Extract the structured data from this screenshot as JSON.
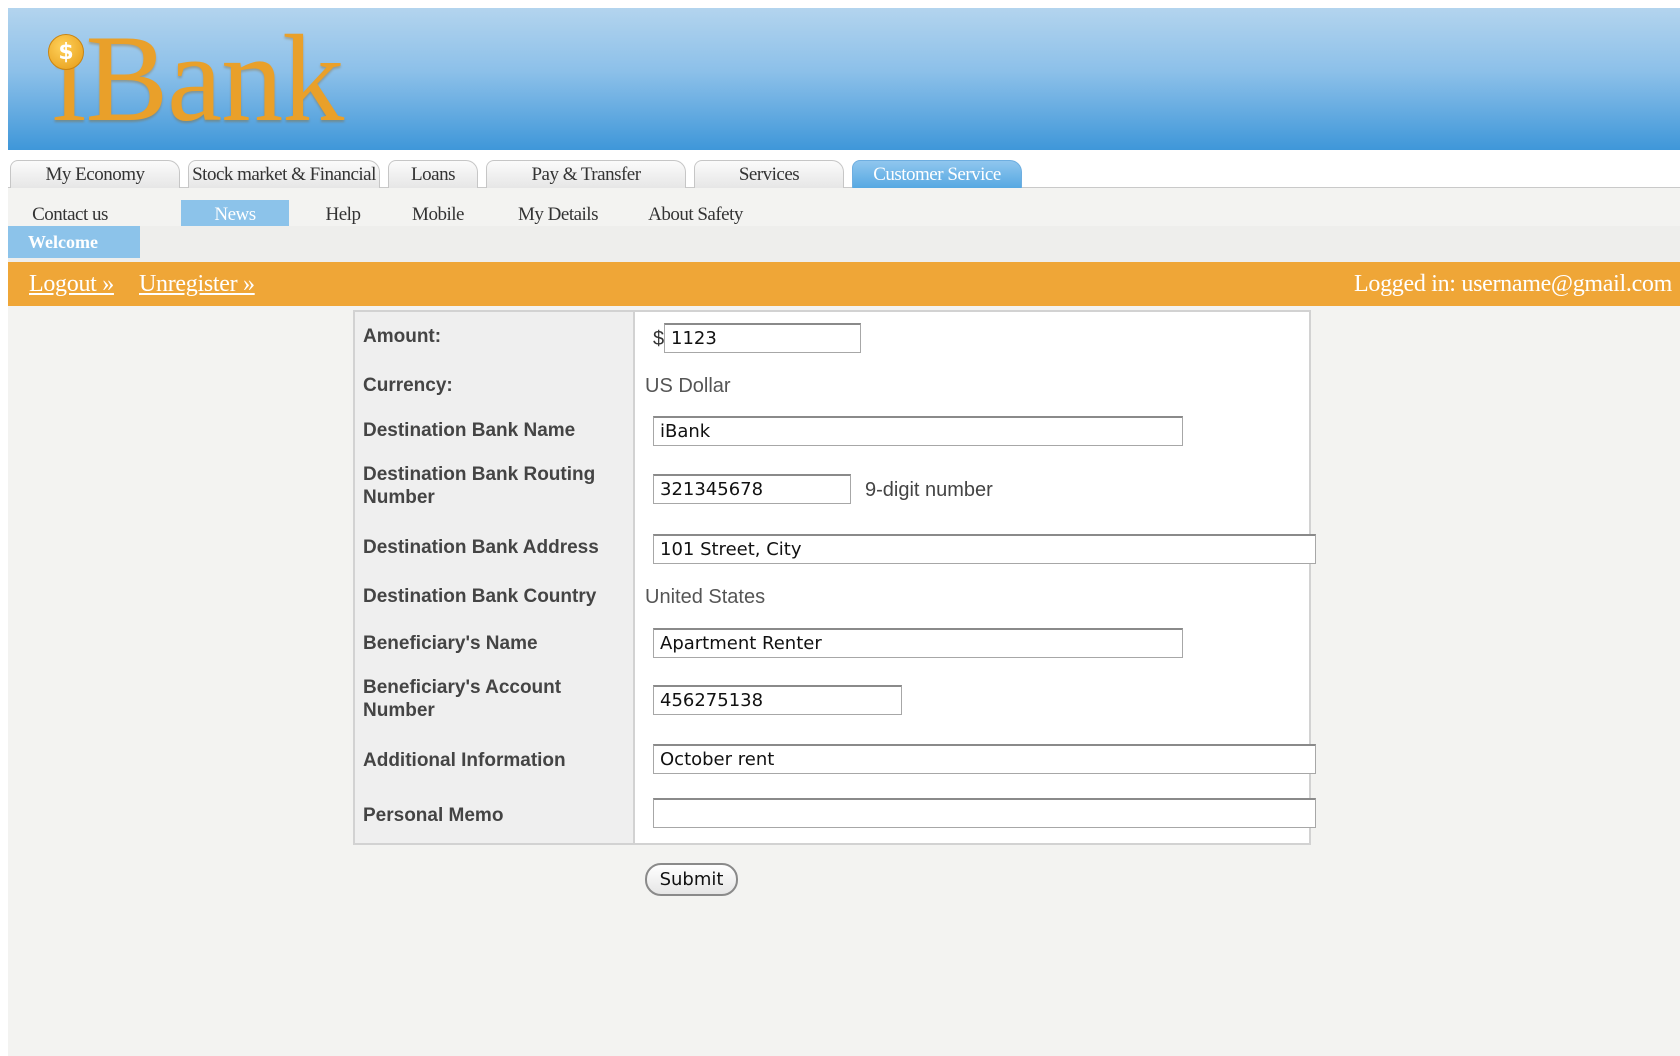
{
  "brand": {
    "logo_text": "iBank",
    "coin_symbol": "$"
  },
  "main_tabs": [
    {
      "label": "My Economy"
    },
    {
      "label": "Stock market & Financial"
    },
    {
      "label": "Loans"
    },
    {
      "label": "Pay & Transfer"
    },
    {
      "label": "Services"
    },
    {
      "label": "Customer Service",
      "active": true
    }
  ],
  "sub_nav": [
    {
      "label": "Contact us"
    },
    {
      "label": "News",
      "active": true
    },
    {
      "label": "Help"
    },
    {
      "label": "Mobile"
    },
    {
      "label": "My Details"
    },
    {
      "label": "About Safety"
    }
  ],
  "welcome_label": "Welcome",
  "user_bar": {
    "logout": "Logout »",
    "unregister": "Unregister »",
    "logged_in": "Logged in: username@gmail.com"
  },
  "form": {
    "amount": {
      "label": "Amount:",
      "currency_symbol": "$",
      "value": "1123"
    },
    "currency": {
      "label": "Currency:",
      "value": "US Dollar"
    },
    "bank_name": {
      "label": "Destination Bank Name",
      "value": "iBank"
    },
    "routing": {
      "label": "Destination Bank Routing Number",
      "value": "321345678",
      "hint": "9-digit number"
    },
    "bank_address": {
      "label": "Destination Bank Address",
      "value": "101 Street, City"
    },
    "bank_country": {
      "label": "Destination Bank Country",
      "value": "United States"
    },
    "beneficiary_name": {
      "label": "Beneficiary's Name",
      "value": "Apartment Renter"
    },
    "beneficiary_account": {
      "label": "Beneficiary's Account Number",
      "value": "456275138"
    },
    "additional_info": {
      "label": "Additional Information",
      "value": "October rent"
    },
    "personal_memo": {
      "label": "Personal Memo",
      "value": ""
    },
    "submit_label": "Submit"
  },
  "colors": {
    "header_blue": "#3f97d9",
    "accent_blue": "#8cc3ea",
    "orange_bar": "#efa637",
    "logo_gold": "#e9a02a"
  }
}
